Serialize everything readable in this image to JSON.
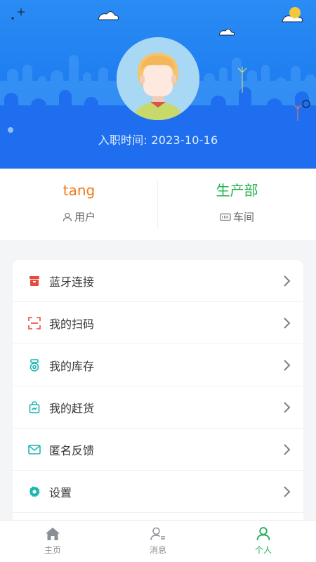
{
  "header": {
    "join_label": "入职时间:",
    "join_date": "2023-10-16"
  },
  "profile": {
    "name": "tang",
    "name_label": "用户",
    "department": "生产部",
    "department_label": "车间"
  },
  "menu": {
    "items": [
      {
        "label": "蓝牙连接",
        "icon": "bluetooth-box-icon",
        "color": "#e84a3c"
      },
      {
        "label": "我的扫码",
        "icon": "scan-icon",
        "color": "#e84a3c"
      },
      {
        "label": "我的库存",
        "icon": "medal-icon",
        "color": "#1fb6b0"
      },
      {
        "label": "我的赶货",
        "icon": "bag-icon",
        "color": "#1fb6b0"
      },
      {
        "label": "匿名反馈",
        "icon": "mail-icon",
        "color": "#1fb6b0"
      },
      {
        "label": "设置",
        "icon": "gear-icon",
        "color": "#1fb6b0"
      }
    ]
  },
  "tabbar": {
    "tabs": [
      {
        "label": "主页",
        "icon": "home-icon"
      },
      {
        "label": "消息",
        "icon": "message-user-icon"
      },
      {
        "label": "个人",
        "icon": "person-icon",
        "active": true
      }
    ]
  },
  "colors": {
    "header_blue": "#1e7cf0",
    "accent_orange": "#f07a1a",
    "accent_green": "#25b14f",
    "active_tab": "#1fae54"
  }
}
